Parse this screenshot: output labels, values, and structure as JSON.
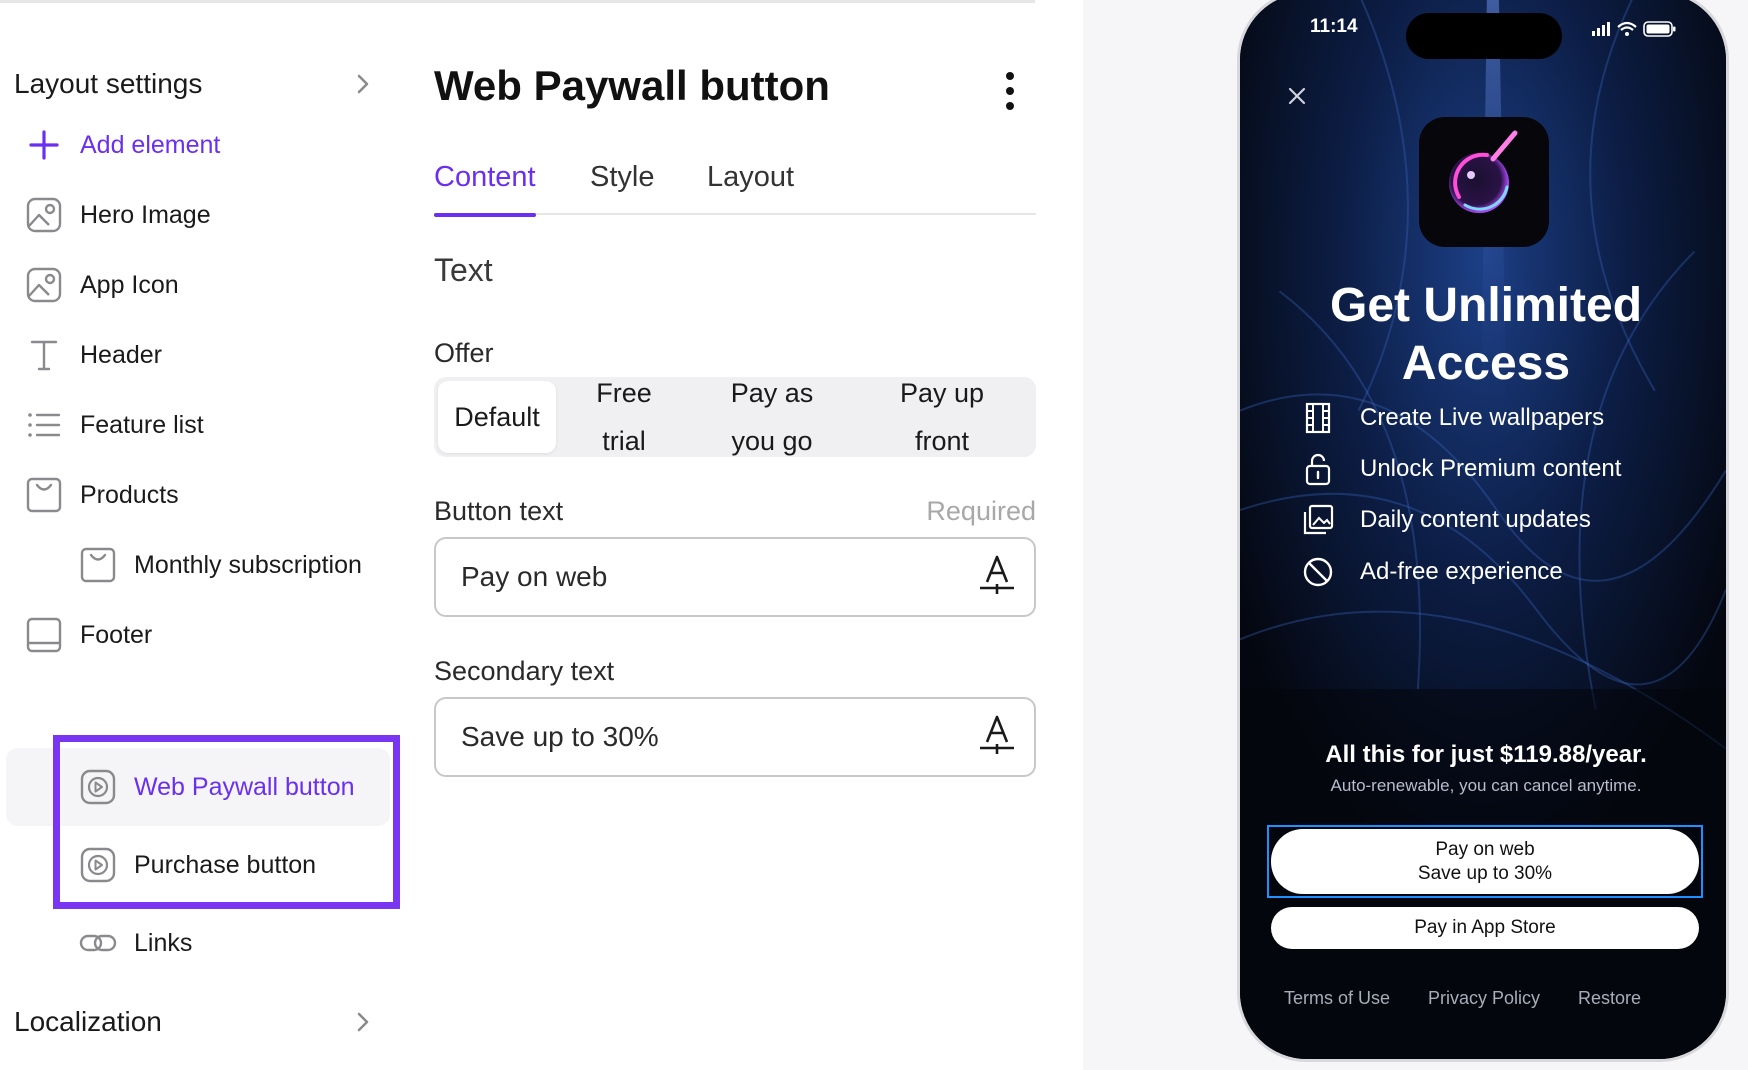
{
  "sidebar": {
    "layout_settings_label": "Layout settings",
    "add_element_label": "Add element",
    "items": [
      {
        "label": "Hero Image",
        "icon": "image-icon"
      },
      {
        "label": "App Icon",
        "icon": "image-icon"
      },
      {
        "label": "Header",
        "icon": "text-icon"
      },
      {
        "label": "Feature list",
        "icon": "list-icon"
      },
      {
        "label": "Products",
        "icon": "bag-icon"
      },
      {
        "label": "Monthly subscription",
        "icon": "bag-icon"
      },
      {
        "label": "Footer",
        "icon": "footer-icon"
      },
      {
        "label": "Web Paywall button",
        "icon": "play-icon"
      },
      {
        "label": "Purchase button",
        "icon": "play-icon"
      },
      {
        "label": "Links",
        "icon": "link-icon"
      }
    ],
    "localization_label": "Localization",
    "accent_color": "#6a2ff0"
  },
  "panel": {
    "title": "Web Paywall button",
    "tabs": [
      "Content",
      "Style",
      "Layout"
    ],
    "active_tab": "Content",
    "section_title": "Text",
    "offer_label": "Offer",
    "offer_options": [
      {
        "line1": "Default",
        "line2": ""
      },
      {
        "line1": "Free",
        "line2": "trial"
      },
      {
        "line1": "Pay as",
        "line2": "you go"
      },
      {
        "line1": "Pay up",
        "line2": "front"
      }
    ],
    "offer_selected": "Default",
    "button_text_label": "Button text",
    "required_label": "Required",
    "button_text_value": "Pay on web",
    "secondary_text_label": "Secondary text",
    "secondary_text_value": "Save up to 30%"
  },
  "phone": {
    "time": "11:14",
    "headline_line1": "Get Unlimited",
    "headline_line2": "Access",
    "features": [
      {
        "text": "Create Live wallpapers",
        "icon": "film-icon"
      },
      {
        "text": "Unlock Premium content",
        "icon": "unlock-icon"
      },
      {
        "text": "Daily content updates",
        "icon": "gallery-icon"
      },
      {
        "text": "Ad-free experience",
        "icon": "block-icon"
      }
    ],
    "price_text": "All this for just $119.88/year.",
    "price_subtext": "Auto-renewable, you can cancel anytime.",
    "web_button_line1": "Pay on web",
    "web_button_line2": "Save up to 30%",
    "store_button": "Pay in App Store",
    "links": [
      "Terms of Use",
      "Privacy Policy",
      "Restore"
    ],
    "selection_color": "#1e90ff"
  }
}
